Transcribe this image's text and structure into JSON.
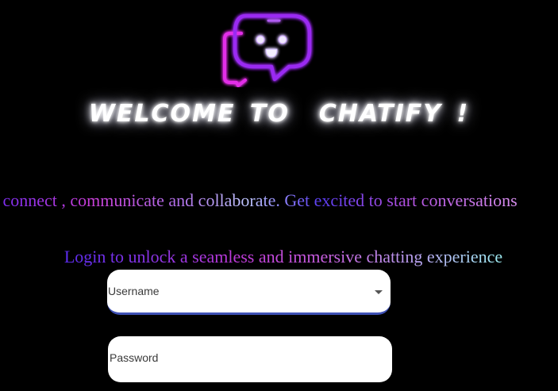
{
  "header": {
    "logo_icon": "chat-bubble-robot-icon",
    "title": "WELCOME TO  CHATIFY !"
  },
  "intro": {
    "tagline": " connect , communicate and collaborate. Get excited to start conversations",
    "subtitle": "Login to unlock a seamless and immersive chatting experience"
  },
  "login_form": {
    "username_label": "Username",
    "password_label": "Password",
    "username_dropdown_icon": "caret-down-icon"
  },
  "colors": {
    "background": "#000000",
    "neon_purple": "#8a2be2",
    "neon_magenta": "#e030f0",
    "field_underline": "#3f51b5"
  }
}
